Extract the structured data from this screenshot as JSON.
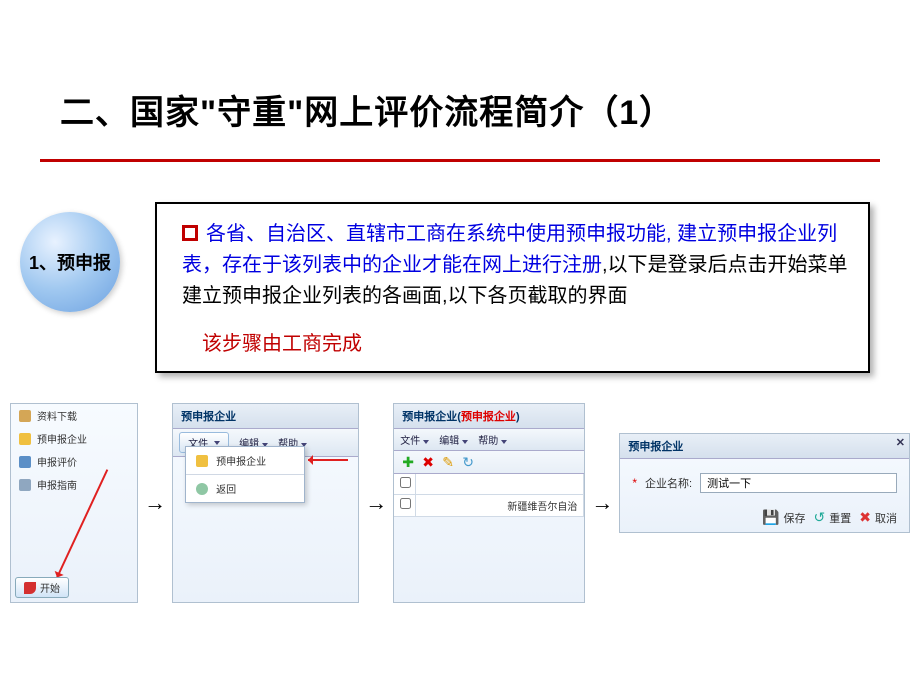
{
  "title": "二、国家\"守重\"网上评价流程简介（1）",
  "step": {
    "number_label": "1、预申报"
  },
  "body": {
    "line_blue": "各省、自治区、直辖市工商在系统中使用预申报功能, 建立预申报企业列表，存在于该列表中的企业才能在网上进行注册",
    "line_black": ",以下是登录后点击开始菜单建立预申报企业列表的各画面,以下各页截取的界面",
    "footnote": "该步骤由工商完成"
  },
  "screenshot1": {
    "sidebar": {
      "item1": "资料下载",
      "item2": "预申报企业",
      "item3": "申报评价",
      "item4": "申报指南"
    },
    "start_button": "开始"
  },
  "screenshot2": {
    "panel_title": "预申报企业",
    "toolbar": {
      "file": "文件",
      "edit": "编辑",
      "help": "帮助"
    },
    "dropdown": {
      "item1": "预申报企业",
      "item2": "返回"
    }
  },
  "screenshot3": {
    "panel_title_prefix": "预申报企业(",
    "panel_title_red": "预申报企业",
    "panel_title_suffix": ")",
    "toolbar": {
      "file": "文件",
      "edit": "编辑",
      "help": "帮助"
    },
    "row1_text": "新疆维吾尔自治"
  },
  "screenshot4": {
    "panel_title": "预申报企业",
    "field_label": "企业名称:",
    "field_value": "测试一下",
    "buttons": {
      "save": "保存",
      "reset": "重置",
      "cancel": "取消"
    }
  }
}
